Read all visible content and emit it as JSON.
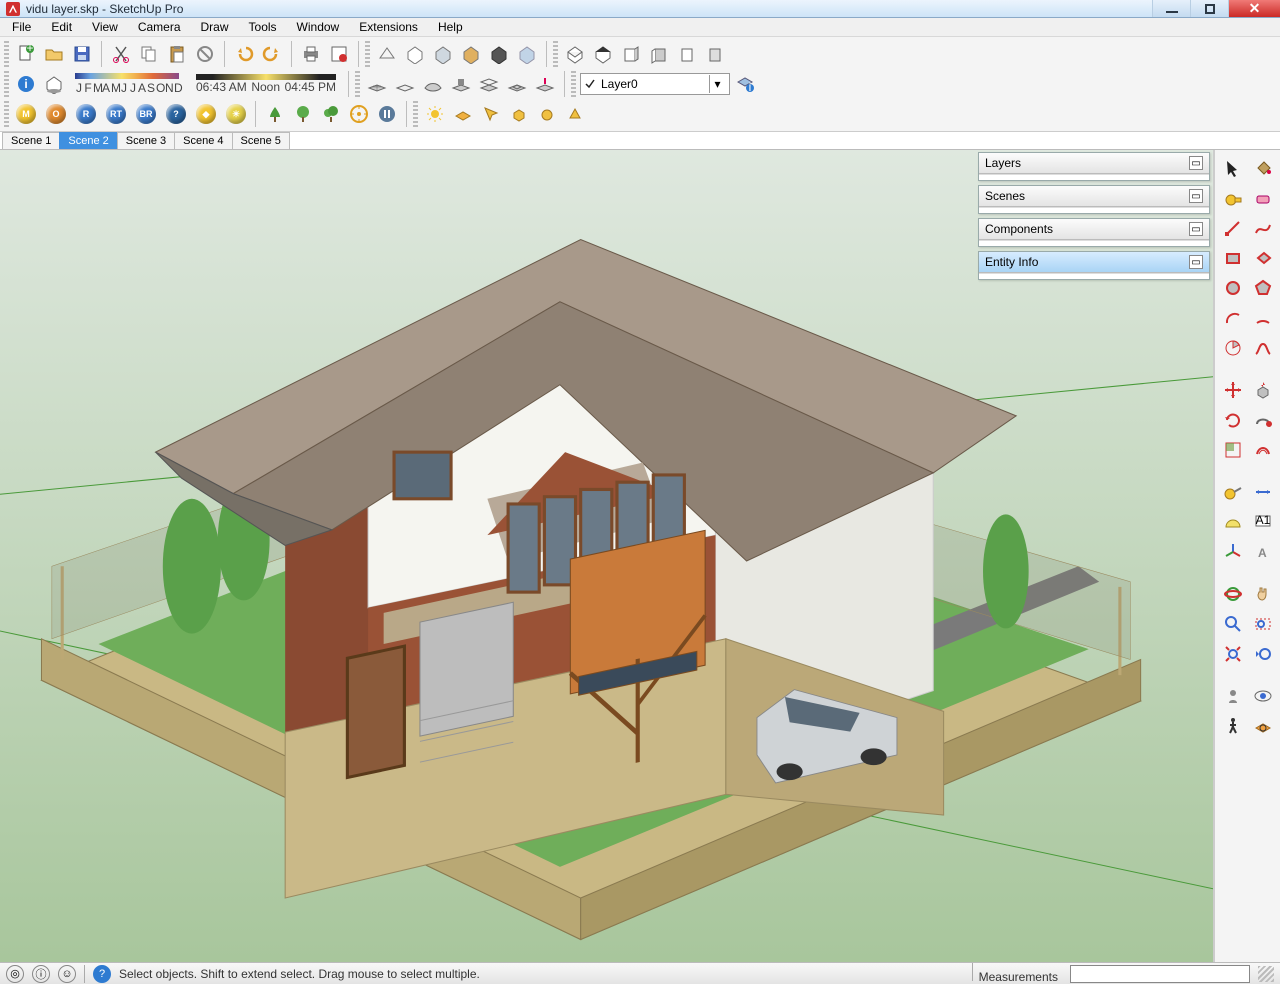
{
  "window": {
    "title": "vidu layer.skp - SketchUp Pro"
  },
  "menu": [
    "File",
    "Edit",
    "View",
    "Camera",
    "Draw",
    "Tools",
    "Window",
    "Extensions",
    "Help"
  ],
  "months": [
    "J",
    "F",
    "M",
    "A",
    "M",
    "J",
    "J",
    "A",
    "S",
    "O",
    "N",
    "D"
  ],
  "time": {
    "start": "06:43 AM",
    "mid": "Noon",
    "end": "04:45 PM"
  },
  "layer": {
    "current": "Layer0"
  },
  "scenes": [
    "Scene 1",
    "Scene 2",
    "Scene 3",
    "Scene 4",
    "Scene 5"
  ],
  "active_scene": 1,
  "panels": [
    "Layers",
    "Scenes",
    "Components",
    "Entity Info"
  ],
  "active_panel": 3,
  "status": {
    "hint": "Select objects. Shift to extend select. Drag mouse to select multiple.",
    "measurements_label": "Measurements"
  },
  "icons": {
    "row1": [
      "new-file",
      "open-file",
      "save-file",
      "cut",
      "copy",
      "paste",
      "delete",
      "undo",
      "redo",
      "print",
      "model-info",
      "sep",
      "xray",
      "hidden-line",
      "shaded",
      "shaded-textures",
      "monochrome",
      "styles",
      "sep",
      "component",
      "group",
      "make-unique",
      "explode",
      "outliner"
    ],
    "row2_a": [
      "info-ball",
      "shadows"
    ],
    "row2_b": [
      "sandbox-mesh",
      "sandbox-from",
      "sandbox-stamp",
      "sandbox-drape",
      "sandbox-smoove",
      "sandbox-flip",
      "sandbox-detail"
    ],
    "row2_c": [
      "layer-info"
    ],
    "row3": [
      {
        "bg": "#f2c430",
        "tx": "M"
      },
      {
        "bg": "#e08a2e",
        "tx": "O"
      },
      {
        "bg": "#3a7acb",
        "tx": "R"
      },
      {
        "bg": "#3a7acb",
        "tx": "RT"
      },
      {
        "bg": "#3a7acb",
        "tx": "BR"
      },
      {
        "bg": "#2a64a0",
        "tx": "?"
      },
      {
        "bg": "#f2c430",
        "tx": "◆"
      },
      {
        "bg": "#e6d24a",
        "tx": "☀"
      }
    ],
    "row3_b": [
      "tree1",
      "tree2",
      "tree3",
      "target",
      "pause"
    ],
    "row3_c": [
      "sun",
      "layer-plane",
      "pointer-yellow",
      "box-small",
      "sphere-small",
      "cone-small"
    ],
    "side_tools": [
      [
        "select",
        "paint-bucket"
      ],
      [
        "measure-tape",
        "eraser"
      ],
      [
        "line",
        "freehand"
      ],
      [
        "rectangle",
        "rotated-rectangle"
      ],
      [
        "circle",
        "polygon"
      ],
      [
        "arc",
        "two-point-arc"
      ],
      [
        "pie",
        "curve"
      ],
      [
        "",
        ""
      ],
      [
        "move",
        "push-pull"
      ],
      [
        "rotate",
        "follow-me"
      ],
      [
        "scale",
        "offset"
      ],
      [
        "",
        ""
      ],
      [
        "tape-measure",
        "dimension"
      ],
      [
        "protractor",
        "text"
      ],
      [
        "axes",
        "3d-text"
      ],
      [
        "",
        ""
      ],
      [
        "orbit",
        "pan"
      ],
      [
        "zoom",
        "zoom-window"
      ],
      [
        "zoom-extents",
        "previous-view"
      ],
      [
        "",
        ""
      ],
      [
        "position-camera",
        "look-around"
      ],
      [
        "walk",
        "section-plane"
      ]
    ]
  }
}
